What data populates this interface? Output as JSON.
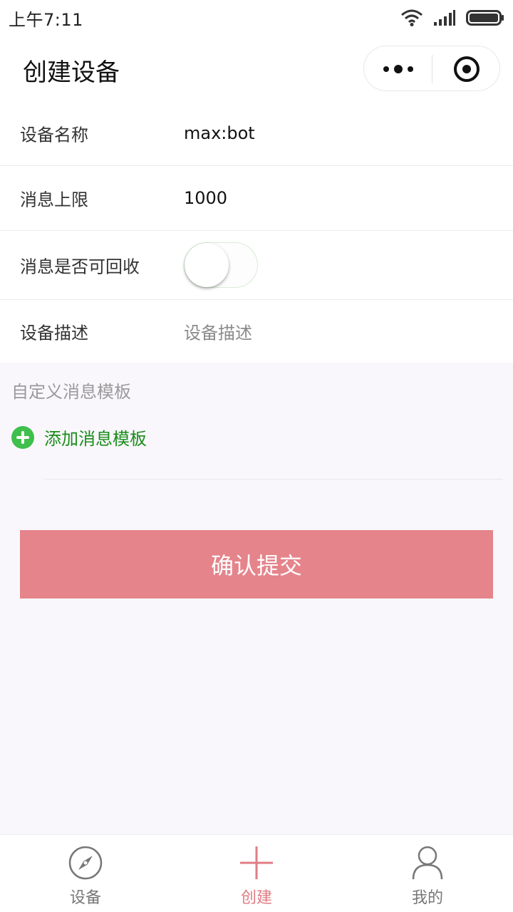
{
  "status_bar": {
    "time": "上午7:11"
  },
  "header": {
    "title": "创建设备"
  },
  "form": {
    "rows": [
      {
        "label": "设备名称",
        "value": "max:bot"
      },
      {
        "label": "消息上限",
        "value": "1000"
      },
      {
        "label": "消息是否可回收",
        "switch_on": false
      },
      {
        "label": "设备描述",
        "placeholder": "设备描述"
      }
    ]
  },
  "templates": {
    "section_title": "自定义消息模板",
    "add_label": "添加消息模板"
  },
  "submit": {
    "label": "确认提交",
    "color": "#e5848b"
  },
  "tab_bar": {
    "active_color": "#e07c84",
    "tabs": [
      {
        "label": "设备",
        "icon": "compass-icon"
      },
      {
        "label": "创建",
        "icon": "plus-icon",
        "active": true
      },
      {
        "label": "我的",
        "icon": "person-icon"
      }
    ]
  }
}
